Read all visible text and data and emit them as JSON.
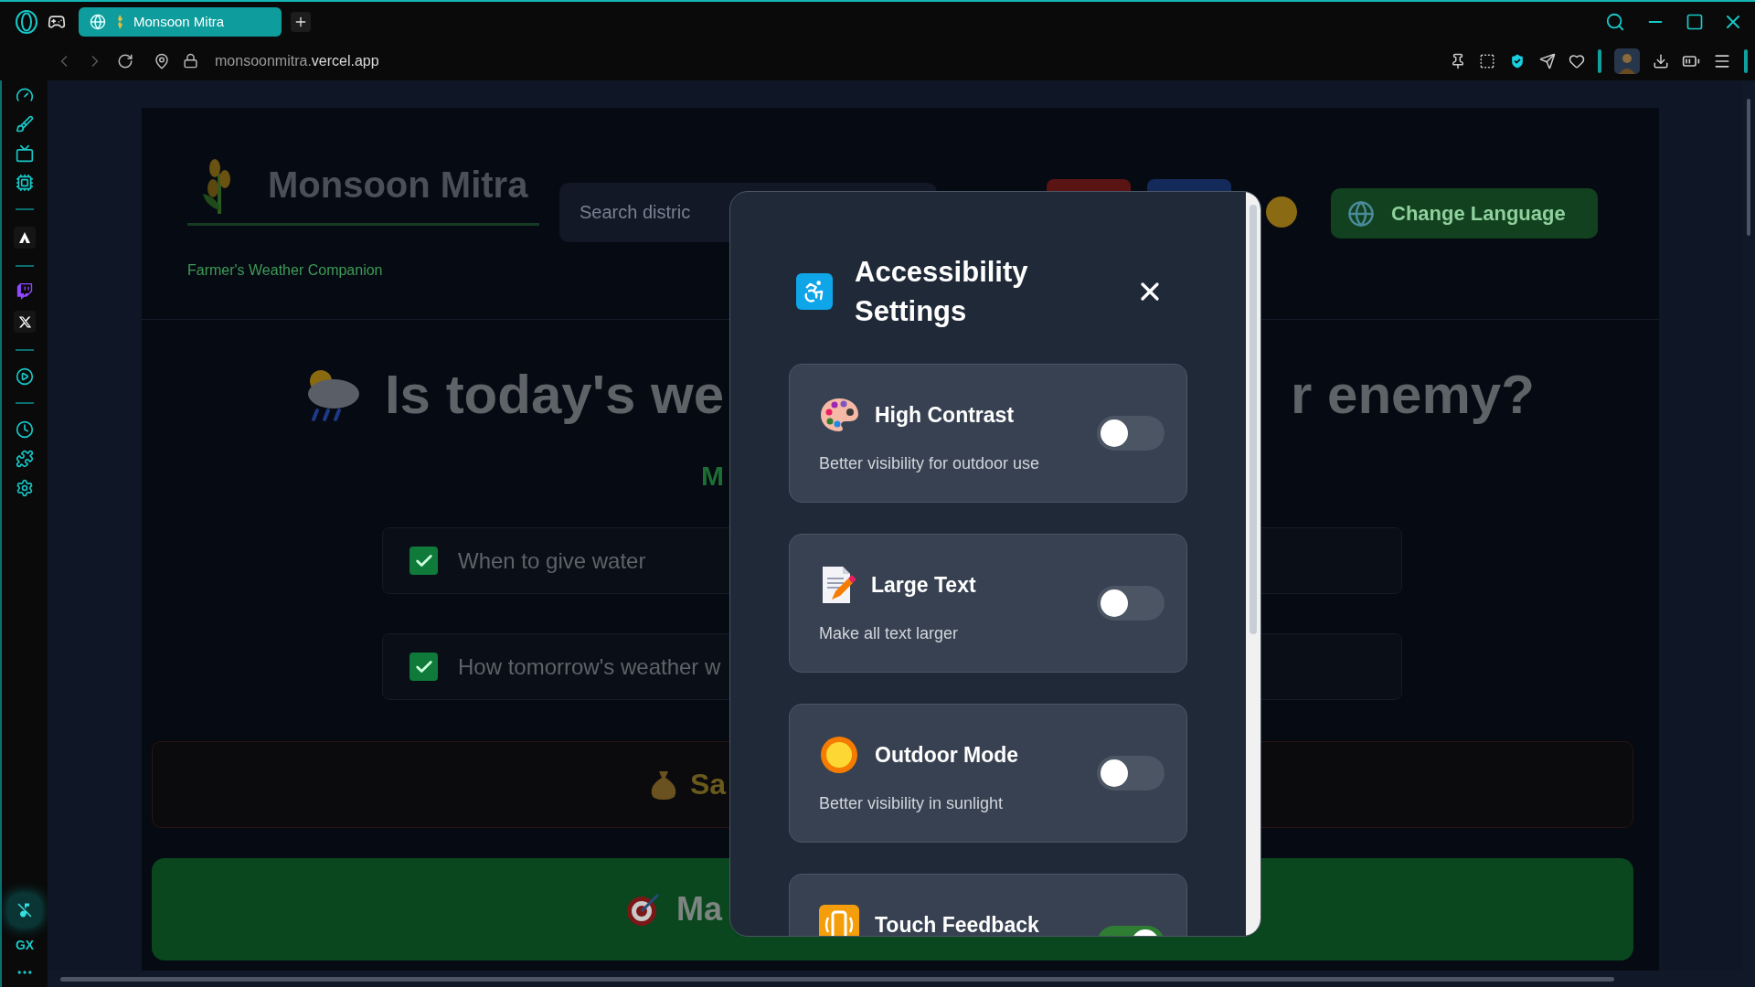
{
  "browser": {
    "tab": {
      "title": "Monsoon Mitra",
      "selected": true
    },
    "url": {
      "subdomain": "monsoonmitra.",
      "domain": "vercel.app"
    }
  },
  "sidebar": {
    "brand_label": "GX"
  },
  "page": {
    "header": {
      "title": "Monsoon Mitra",
      "subtitle": "Farmer's Weather Companion",
      "search": {
        "placeholder": "Search distric"
      },
      "language_button": "Change Language"
    },
    "headline": {
      "left": "Is today's we",
      "right": "r enemy?"
    },
    "tagline": "M",
    "checklist": [
      {
        "text": "When to give water",
        "checked": true
      },
      {
        "text": "How tomorrow's weather w",
        "checked": true
      }
    ],
    "savings_banner": "Sa",
    "main_button": "Ma"
  },
  "modal": {
    "title": "Accessibility Settings",
    "settings": [
      {
        "kind": "palette",
        "title": "High Contrast",
        "description": "Better visibility for outdoor use",
        "on": false
      },
      {
        "kind": "document",
        "title": "Large Text",
        "description": "Make all text larger",
        "on": false
      },
      {
        "kind": "sun",
        "title": "Outdoor Mode",
        "description": "Better visibility in sunlight",
        "on": false
      },
      {
        "kind": "vibration",
        "title": "Touch Feedback",
        "on": true
      }
    ]
  }
}
